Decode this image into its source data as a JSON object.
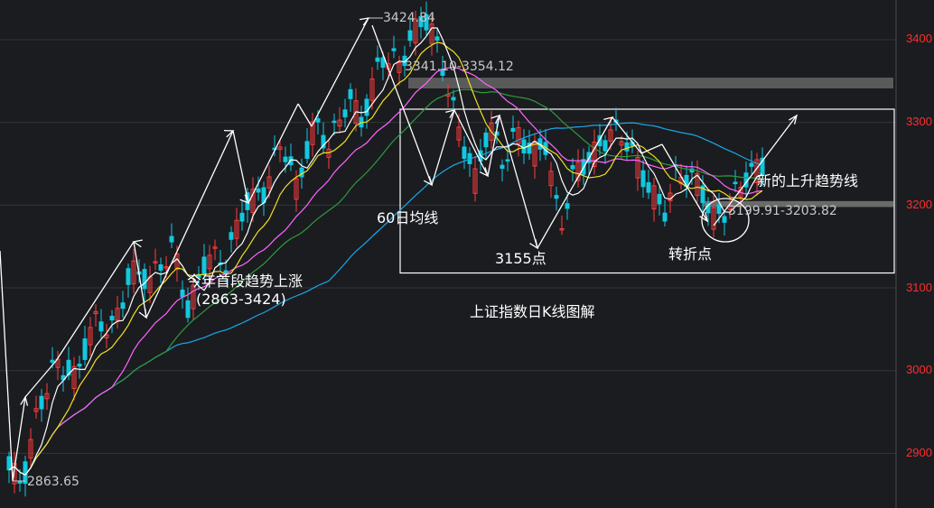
{
  "chart_data": {
    "type": "candlestick",
    "title": "上证指数日K线图解",
    "y_ticks": [
      2900,
      3000,
      3100,
      3200,
      3300,
      3400
    ],
    "y_tick_labels": [
      "2900",
      "3000",
      "3100",
      "3200",
      "3300",
      "3400"
    ],
    "ylim": [
      2840,
      3445
    ],
    "grid": true,
    "colors": {
      "up": "#ff3b3b",
      "down": "#11c8e0",
      "ma5": "#ffffff",
      "ma10": "#f0e020",
      "ma20": "#ff66ff",
      "ma30": "#2f9a3c",
      "ma60": "#19a8e8"
    },
    "annotations": {
      "low_label": "2863.65",
      "high_label": "3424.84",
      "resist_label": "3341.10-3354.12",
      "support_label": "3199.91-3203.82",
      "ma60_label": "60日均线",
      "low_3155_label": "3155点",
      "turn_label": "转折点",
      "trend_label": "新的上升趋势线",
      "first_leg_label": "今年首段趋势上涨",
      "first_leg_range": "(2863-3424)"
    },
    "notable_levels": {
      "low": 2863.65,
      "high": 3424.84,
      "resistance_low": 3341.1,
      "resistance_high": 3354.12,
      "support_low": 3199.91,
      "support_high": 3203.82,
      "low_3155": 3155,
      "range_top": 3316,
      "range_bottom": 3118
    }
  }
}
